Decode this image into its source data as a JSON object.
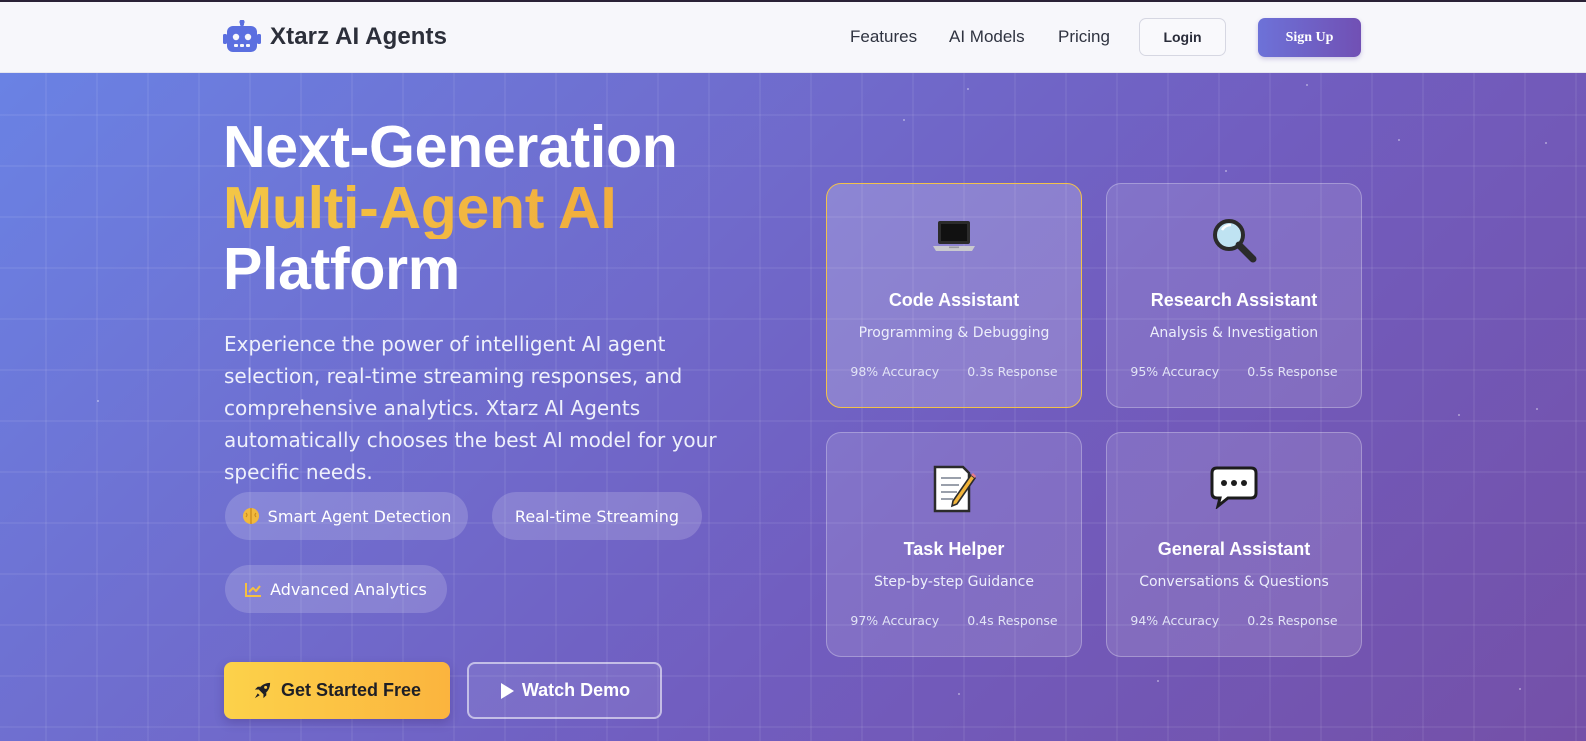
{
  "brand": {
    "name": "Xtarz AI Agents",
    "icon": "robot-icon"
  },
  "nav": {
    "links": [
      "Features",
      "AI Models",
      "Pricing"
    ],
    "login_label": "Login",
    "signup_label": "Sign Up"
  },
  "hero": {
    "headline_line1": "Next-Generation",
    "headline_line2": "Multi-Agent AI",
    "headline_line3": "Platform",
    "lead": "Experience the power of intelligent AI agent selection, real-time streaming responses, and comprehensive analytics. Xtarz AI Agents automatically chooses the best AI model for your specific needs.",
    "features": [
      {
        "label": "Smart Agent Detection",
        "icon": "brain-icon"
      },
      {
        "label": "Real-time Streaming",
        "icon": ""
      },
      {
        "label": "Advanced Analytics",
        "icon": "chart-line-icon"
      }
    ],
    "cta_primary": "Get Started Free",
    "cta_secondary": "Watch Demo"
  },
  "agents": [
    {
      "title": "Code Assistant",
      "subtitle": "Programming & Debugging",
      "accuracy": "98% Accuracy",
      "response": "0.3s Response",
      "icon": "laptop-icon",
      "active": true
    },
    {
      "title": "Research Assistant",
      "subtitle": "Analysis & Investigation",
      "accuracy": "95% Accuracy",
      "response": "0.5s Response",
      "icon": "magnifier-icon",
      "active": false
    },
    {
      "title": "Task Helper",
      "subtitle": "Step-by-step Guidance",
      "accuracy": "97% Accuracy",
      "response": "0.4s Response",
      "icon": "memo-icon",
      "active": false
    },
    {
      "title": "General Assistant",
      "subtitle": "Conversations & Questions",
      "accuracy": "94% Accuracy",
      "response": "0.2s Response",
      "icon": "speech-bubble-icon",
      "active": false
    }
  ],
  "colors": {
    "accent_gradient_start": "#f3c646",
    "accent_gradient_end": "#f0a33a",
    "primary_purple": "#6d72d8",
    "hero_start": "#6a82e4",
    "hero_end": "#7450a8",
    "active_card_border": "#f2c24a"
  }
}
